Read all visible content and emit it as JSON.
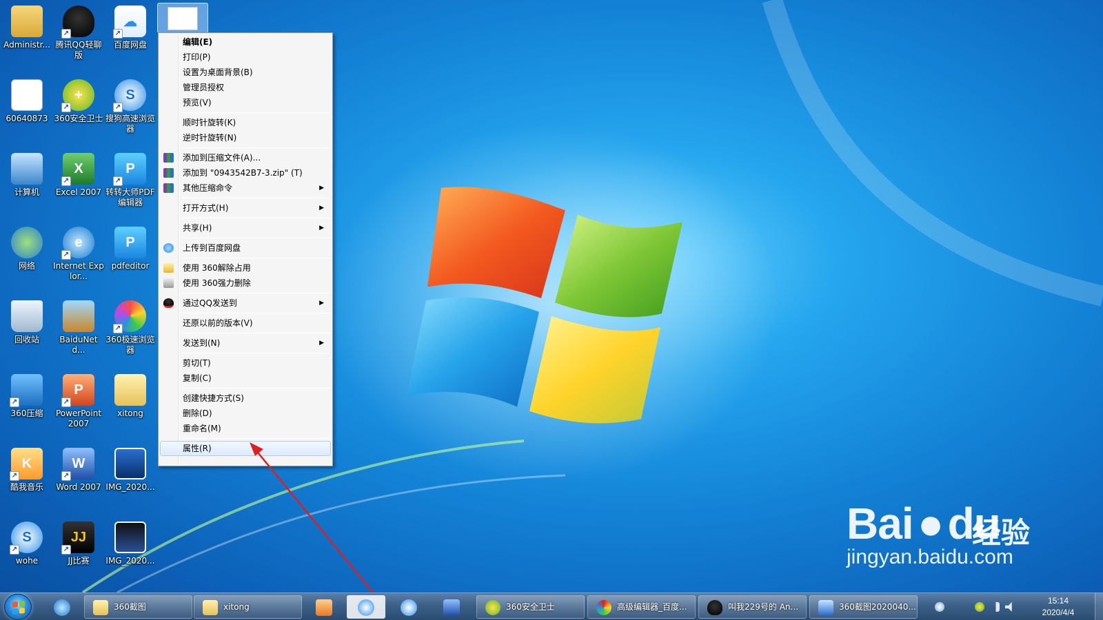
{
  "desktop": {
    "icons": [
      {
        "label": "Administr..."
      },
      {
        "label": "腾讯QQ轻聊版"
      },
      {
        "label": "百度网盘"
      },
      {
        "label": "60640873"
      },
      {
        "label": "360安全卫士"
      },
      {
        "label": "搜狗高速浏览器"
      },
      {
        "label": "计算机"
      },
      {
        "label": "Excel 2007"
      },
      {
        "label": "转转大师PDF编辑器"
      },
      {
        "label": "网络"
      },
      {
        "label": "Internet Explor..."
      },
      {
        "label": "pdfeditor"
      },
      {
        "label": "回收站"
      },
      {
        "label": "BaiduNetd..."
      },
      {
        "label": "360极速浏览器"
      },
      {
        "label": "360压缩"
      },
      {
        "label": "PowerPoint 2007"
      },
      {
        "label": "xitong"
      },
      {
        "label": "酷我音乐"
      },
      {
        "label": "Word 2007"
      },
      {
        "label": "IMG_2020..."
      },
      {
        "label": "wohe"
      },
      {
        "label": "JJ比赛"
      },
      {
        "label": "IMG_2020..."
      }
    ]
  },
  "context_menu": {
    "items": [
      {
        "label": "编辑(E)"
      },
      {
        "label": "打印(P)"
      },
      {
        "label": "设置为桌面背景(B)"
      },
      {
        "label": "管理员授权"
      },
      {
        "label": "预览(V)"
      },
      {
        "label": "顺时针旋转(K)"
      },
      {
        "label": "逆时针旋转(N)"
      },
      {
        "label": "添加到压缩文件(A)..."
      },
      {
        "label": "添加到 \"0943542B7-3.zip\" (T)"
      },
      {
        "label": "其他压缩命令"
      },
      {
        "label": "打开方式(H)"
      },
      {
        "label": "共享(H)"
      },
      {
        "label": "上传到百度网盘"
      },
      {
        "label": "使用 360解除占用"
      },
      {
        "label": "使用 360强力删除"
      },
      {
        "label": "通过QQ发送到"
      },
      {
        "label": "还原以前的版本(V)"
      },
      {
        "label": "发送到(N)"
      },
      {
        "label": "剪切(T)"
      },
      {
        "label": "复制(C)"
      },
      {
        "label": "创建快捷方式(S)"
      },
      {
        "label": "删除(D)"
      },
      {
        "label": "重命名(M)"
      },
      {
        "label": "属性(R)"
      }
    ]
  },
  "taskbar": {
    "items": [
      {
        "label": "360截图"
      },
      {
        "label": "xitong"
      },
      {
        "label": "360安全卫士"
      },
      {
        "label": "高级编辑器_百度..."
      },
      {
        "label": "叫我229号的 An..."
      },
      {
        "label": "360截图2020040..."
      }
    ],
    "clock_time": "15:14",
    "clock_date": "2020/4/4"
  },
  "watermark": {
    "brand": "Bai",
    "brand_mid": "du",
    "chinese": "经验",
    "url": "jingyan.baidu.com"
  },
  "colors": {
    "annotation_arrow": "#e02020",
    "menu_hover_border": "#aeccef"
  }
}
